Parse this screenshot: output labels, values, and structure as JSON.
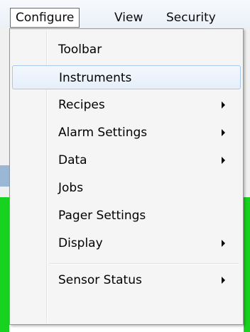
{
  "menubar": {
    "items": [
      {
        "label": "Configure"
      },
      {
        "label": "View"
      },
      {
        "label": "Security"
      }
    ]
  },
  "menu": {
    "items": [
      {
        "label": "Toolbar",
        "submenu": false,
        "highlighted": false
      },
      {
        "label": "Instruments",
        "submenu": false,
        "highlighted": true
      },
      {
        "label": "Recipes",
        "submenu": true,
        "highlighted": false
      },
      {
        "label": "Alarm Settings",
        "submenu": true,
        "highlighted": false
      },
      {
        "label": "Data",
        "submenu": true,
        "highlighted": false
      },
      {
        "label": "Jobs",
        "submenu": false,
        "highlighted": false
      },
      {
        "label": "Pager Settings",
        "submenu": false,
        "highlighted": false
      },
      {
        "label": "Display",
        "submenu": true,
        "highlighted": false
      },
      {
        "label": "Sensor Status",
        "submenu": true,
        "highlighted": false
      }
    ]
  },
  "colors": {
    "highlight_border": "#a8c8ec",
    "status_green": "#17d21e"
  }
}
